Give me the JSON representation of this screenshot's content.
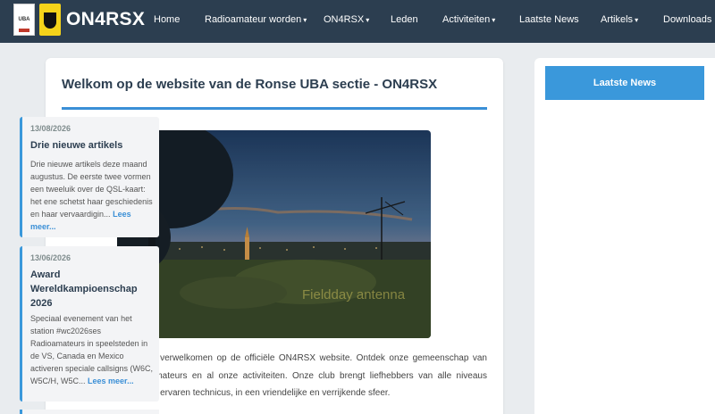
{
  "navbar": {
    "logo_uba_text": "UBA",
    "logo_crest_text": "ON4RSX",
    "brand": "ON4RSX",
    "items": [
      {
        "label": "Home",
        "has_dropdown": false
      },
      {
        "label": "Radioamateur worden",
        "has_dropdown": true
      },
      {
        "label": "ON4RSX",
        "has_dropdown": true
      },
      {
        "label": "Leden",
        "has_dropdown": false
      },
      {
        "label": "Activiteiten",
        "has_dropdown": true
      },
      {
        "label": "Laatste News",
        "has_dropdown": false
      },
      {
        "label": "Artikels",
        "has_dropdown": true
      },
      {
        "label": "Downloads",
        "has_dropdown": false
      }
    ],
    "dropdown_caret": "▾"
  },
  "main": {
    "title": "Welkom op de website van de Ronse UBA sectie - ON4RSX",
    "hero_caption": "Fieldday antenna",
    "intro": "We zijn verheugd je te verwelkomen op de officiële ON4RSX website. Ontdek onze gemeenschap van gepassioneerde radioamateurs en al onze activiteiten. Onze club brengt liefhebbers van alle niveaus samen, van beginner tot ervaren technicus, in een vriendelijke en verrijkende sfeer."
  },
  "sidebar": {
    "header": "Laatste News",
    "news": [
      {
        "date": "13/08/2026",
        "title": "Drie nieuwe artikels",
        "excerpt": "Drie nieuwe artikels deze maand augustus. De eerste twee vormen een tweeluik over de QSL-kaart: het ene schetst haar geschiedenis en haar vervaardigin...",
        "more": "Lees meer..."
      },
      {
        "date": "13/06/2026",
        "title": "Award Wereldkampioenschap 2026",
        "excerpt": "Speciaal evenement van het station #wc2026ses Radioamateurs in speelsteden in de VS, Canada en Mexico activeren speciale callsigns (W6C, W5C/H, W5C...",
        "more": "Lees meer..."
      }
    ]
  },
  "colors": {
    "navbar_bg": "#2c3e50",
    "accent": "#3a98db",
    "page_bg": "#e9ecef"
  }
}
